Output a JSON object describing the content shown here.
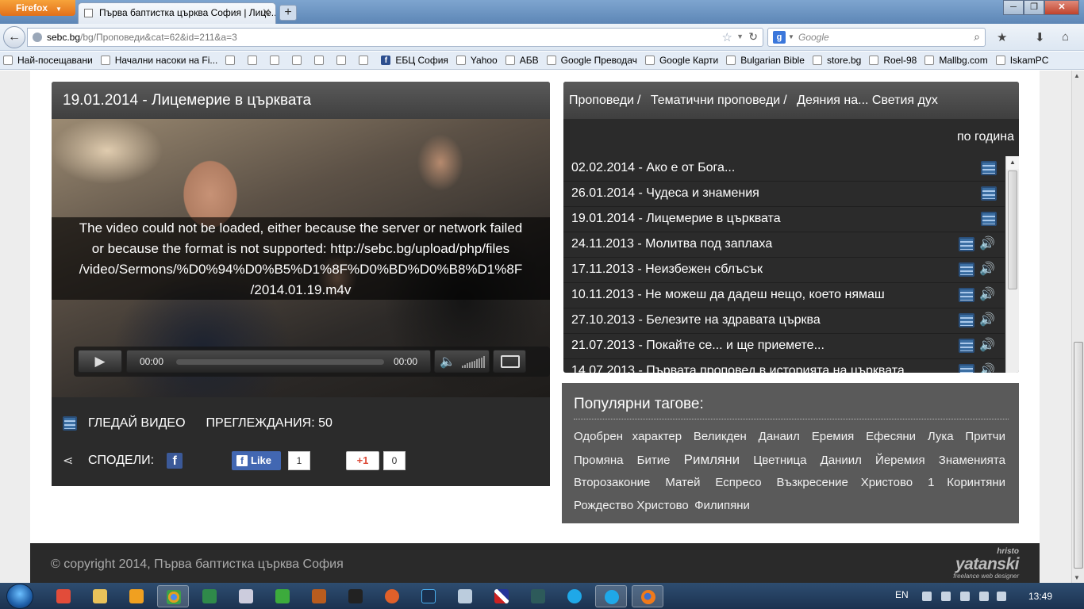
{
  "browser": {
    "app_button": "Firefox",
    "tab_title": "Първа баптистка църква София | Лице...",
    "url_host": "sebc.bg",
    "url_path": "/bg/Проповеди&cat=62&id=211&a=3",
    "search_placeholder": "Google",
    "bookmarks": [
      "Най-посещавани",
      "Начални насоки на Fi...",
      "",
      "",
      "",
      "",
      "",
      "",
      "",
      "ЕБЦ София",
      "Yahoo",
      "АБВ",
      "Google Преводач",
      "Google Карти",
      "Bulgarian Bible",
      "store.bg",
      "Roel-98",
      "Mallbg.com",
      "IskamPC"
    ]
  },
  "video_panel": {
    "title": "19.01.2014 - Лицемерие в църквата",
    "error_line1": "The video could not be loaded, either because the server or network failed",
    "error_line2": "or because the format is not supported: http://sebc.bg/upload/php/files",
    "error_line3": "/video/Sermons/%D0%94%D0%B5%D1%8F%D0%BD%D0%B8%D1%8F",
    "error_line4": "/2014.01.19.m4v",
    "current_time": "00:00",
    "duration": "00:00",
    "progress": 0,
    "volume_level": 1.0,
    "watch_label": "ГЛЕДАЙ ВИДЕО",
    "views_label": "ПРЕГЛЕЖДАНИЯ: 50",
    "share_label": "СПОДЕЛИ:",
    "fb_like_label": "Like",
    "fb_like_count": "1",
    "gplus_label": "+1",
    "gplus_count": "0"
  },
  "list_panel": {
    "crumb1": "Проповеди",
    "crumb2": "Тематични проповеди",
    "crumb3": "Деяния на... Светия дух",
    "separator": "/",
    "by_year": "по година",
    "sermons": [
      {
        "title": "02.02.2014 - Ако е от Бога...",
        "video": true,
        "audio": false
      },
      {
        "title": "26.01.2014 - Чудеса и знамения",
        "video": true,
        "audio": false
      },
      {
        "title": "19.01.2014 - Лицемерие в църквата",
        "video": true,
        "audio": false
      },
      {
        "title": "24.11.2013 - Молитва под заплаха",
        "video": true,
        "audio": true
      },
      {
        "title": "17.11.2013 - Неизбежен сблъсък",
        "video": true,
        "audio": true
      },
      {
        "title": "10.11.2013 - Не можеш да дадеш нещо, което нямаш",
        "video": true,
        "audio": true
      },
      {
        "title": "27.10.2013 - Белезите на здравата църква",
        "video": true,
        "audio": true
      },
      {
        "title": "21.07.2013 - Покайте се... и ще приемете...",
        "video": true,
        "audio": true
      },
      {
        "title": "14.07.2013 - Първата проповед в историята на църквата",
        "video": true,
        "audio": true
      }
    ]
  },
  "tags_panel": {
    "title": "Популярни тагове:",
    "tags": [
      {
        "label": "Одобрен характер",
        "big": false
      },
      {
        "label": "Великден",
        "big": false
      },
      {
        "label": "Данаил",
        "big": false
      },
      {
        "label": "Еремия",
        "big": false
      },
      {
        "label": "Ефесяни",
        "big": false
      },
      {
        "label": "Лука",
        "big": false
      },
      {
        "label": "Притчи",
        "big": false
      },
      {
        "label": "Промяна",
        "big": false
      },
      {
        "label": "Битие",
        "big": false
      },
      {
        "label": "Римляни",
        "big": true
      },
      {
        "label": "Цветница",
        "big": false
      },
      {
        "label": "Даниил",
        "big": false
      },
      {
        "label": "Йеремия",
        "big": false
      },
      {
        "label": "Знаменията",
        "big": false
      },
      {
        "label": "Второзаконие",
        "big": false
      },
      {
        "label": "Матей",
        "big": false
      },
      {
        "label": "Еспресо",
        "big": false
      },
      {
        "label": "Възкресение Христово",
        "big": false
      },
      {
        "label": "1 Коринтяни",
        "big": false
      },
      {
        "label": "Рождество Христово",
        "big": false
      },
      {
        "label": "Филипяни",
        "big": false
      }
    ]
  },
  "footer": {
    "copyright": "© copyright 2014, Първа баптистка църква София",
    "logo_top": "hristo",
    "logo_main": "yatanski",
    "logo_sub": "freelance web designer"
  },
  "taskbar": {
    "language": "EN",
    "time": "13:49"
  },
  "colors": {
    "panel_dark": "#2b2b2b",
    "panel_header": "#4a4a4a",
    "tag_panel": "#5a5a5a",
    "audio_icon": "#4aa3ff",
    "video_icon": "#3c6fa3"
  }
}
